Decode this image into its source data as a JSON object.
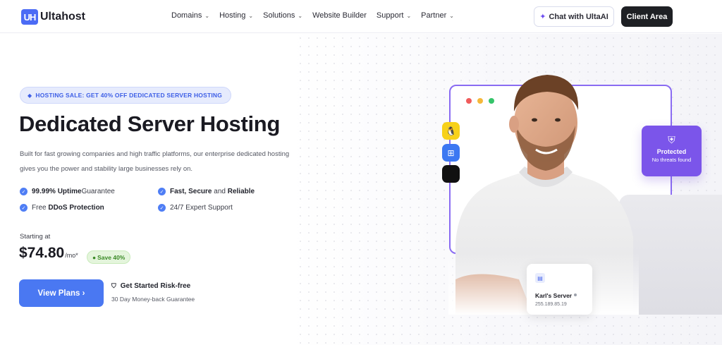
{
  "header": {
    "logo_mark": "UH",
    "logo_text": "Ultahost",
    "nav": [
      {
        "label": "Domains",
        "has_dropdown": true
      },
      {
        "label": "Hosting",
        "has_dropdown": true
      },
      {
        "label": "Solutions",
        "has_dropdown": true
      },
      {
        "label": "Website Builder",
        "has_dropdown": false
      },
      {
        "label": "Support",
        "has_dropdown": true
      },
      {
        "label": "Partner",
        "has_dropdown": true
      }
    ],
    "chat_label": "Chat with UltaAI",
    "client_area_label": "Client Area"
  },
  "hero": {
    "sale_badge": "HOSTING SALE: GET 40% OFF DEDICATED SERVER HOSTING",
    "title": "Dedicated Server Hosting",
    "description": "Built for fast growing companies and high traffic platforms, our enterprise dedicated hosting gives you the power and stability large businesses rely on.",
    "features": [
      {
        "bold": "99.99% Uptime",
        "rest": " Guarantee"
      },
      {
        "bold": "Fast, Secure",
        "rest": " and ",
        "bold2": "Reliable"
      },
      {
        "pre": "Free ",
        "bold": "DDoS Protection"
      },
      {
        "rest": "24/7 Expert Support"
      }
    ],
    "starting_at": "Starting at",
    "price": "$74.80",
    "price_unit": "/mo*",
    "save_badge": "Save 40%",
    "cta_label": "View Plans ›",
    "risk_free": "Get Started Risk-free",
    "money_back": "30 Day Money-back Guarantee"
  },
  "visual": {
    "os_icons": [
      "linux-icon",
      "windows-icon",
      "apple-icon"
    ],
    "protected_title": "Protected",
    "protected_sub": "No threats found",
    "server_name": "Karl's Server",
    "server_ip": "255.189.85.19"
  },
  "colors": {
    "accent": "#4a78f2",
    "purple": "#7b55ea",
    "dark": "#1e2024"
  }
}
